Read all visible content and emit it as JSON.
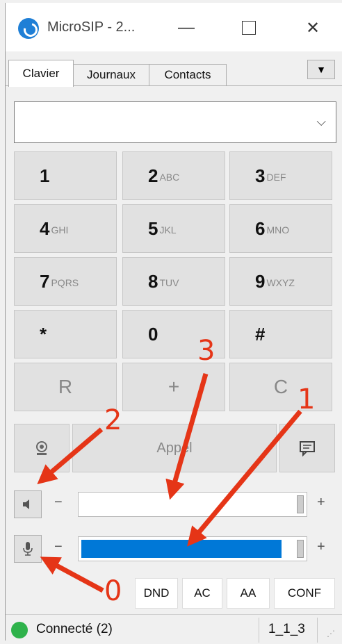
{
  "window": {
    "title": "MicroSIP - 2...",
    "min_glyph": "—",
    "close_glyph": "✕",
    "icon": "microsip-logo-icon"
  },
  "tabs": [
    {
      "label": "Clavier",
      "active": true
    },
    {
      "label": "Journaux",
      "active": false
    },
    {
      "label": "Contacts",
      "active": false
    }
  ],
  "tab_dropdown_glyph": "▼",
  "dial_input": {
    "value": "",
    "arrow_glyph": "⌵"
  },
  "keypad": [
    {
      "digit": "1",
      "letters": ""
    },
    {
      "digit": "2",
      "letters": "ABC"
    },
    {
      "digit": "3",
      "letters": "DEF"
    },
    {
      "digit": "4",
      "letters": "GHI"
    },
    {
      "digit": "5",
      "letters": "JKL"
    },
    {
      "digit": "6",
      "letters": "MNO"
    },
    {
      "digit": "7",
      "letters": "PQRS"
    },
    {
      "digit": "8",
      "letters": "TUV"
    },
    {
      "digit": "9",
      "letters": "WXYZ"
    },
    {
      "digit": "*",
      "letters": ""
    },
    {
      "digit": "0",
      "letters": ""
    },
    {
      "digit": "#",
      "letters": ""
    },
    {
      "digit": "R",
      "letters": ""
    },
    {
      "digit": "+",
      "letters": ""
    },
    {
      "digit": "C",
      "letters": ""
    }
  ],
  "call": {
    "label": "Appel",
    "video_icon": "webcam-icon",
    "message_icon": "chat-icon"
  },
  "speaker": {
    "icon": "speaker-icon",
    "minus": "−",
    "plus": "+",
    "level": 0.0
  },
  "microphone": {
    "icon": "microphone-icon",
    "minus": "−",
    "plus": "+",
    "level": 0.9
  },
  "options": [
    "DND",
    "AC",
    "AA",
    "CONF"
  ],
  "status": {
    "text": "Connecté (2)",
    "account": "1_1_3",
    "icon": "connected-icon"
  },
  "annotations": [
    "1",
    "2",
    "3",
    "0"
  ],
  "colors": {
    "accent": "#0078d7",
    "annotation": "#e53517",
    "status_ok": "#2fb24b"
  }
}
